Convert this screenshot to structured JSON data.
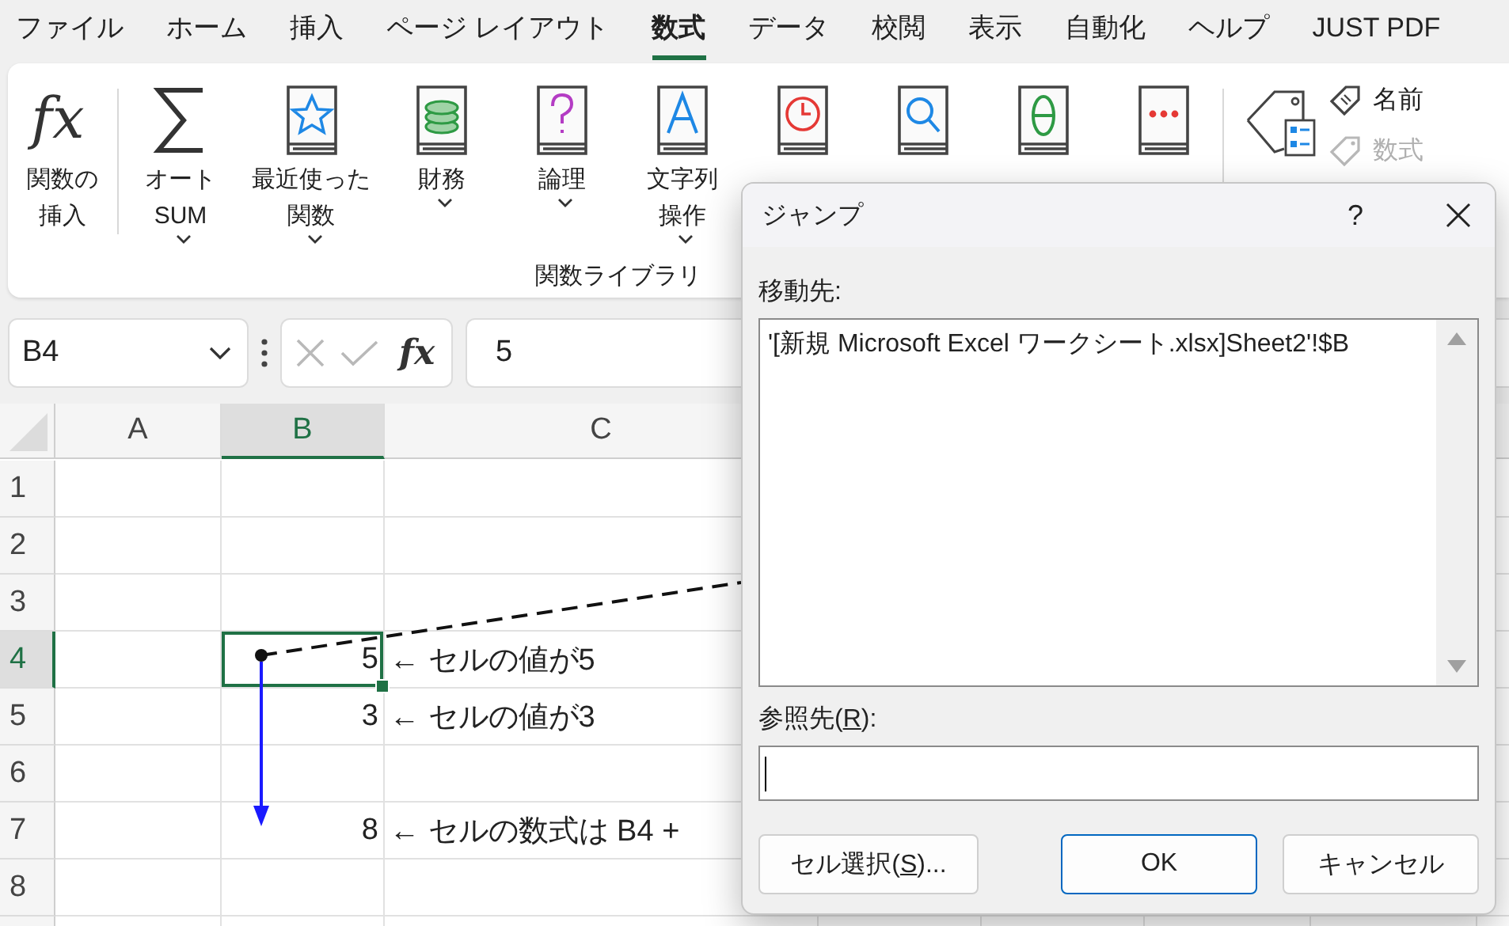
{
  "menu_tabs": [
    {
      "label": "ファイル",
      "selected": false
    },
    {
      "label": "ホーム",
      "selected": false
    },
    {
      "label": "挿入",
      "selected": false
    },
    {
      "label": "ページ レイアウト",
      "selected": false
    },
    {
      "label": "数式",
      "selected": true
    },
    {
      "label": "データ",
      "selected": false
    },
    {
      "label": "校閲",
      "selected": false
    },
    {
      "label": "表示",
      "selected": false
    },
    {
      "label": "自動化",
      "selected": false
    },
    {
      "label": "ヘルプ",
      "selected": false
    },
    {
      "label": "JUST PDF",
      "selected": false
    }
  ],
  "ribbon": {
    "insert_function": {
      "glyph": "fx",
      "label": [
        "関数の",
        "挿入"
      ]
    },
    "library": {
      "title": "関数ライブラリ",
      "items": [
        {
          "kind": "sum",
          "label": [
            "オート",
            "SUM"
          ],
          "dropdown": true
        },
        {
          "kind": "recent",
          "label": [
            "最近使った",
            "関数"
          ],
          "dropdown": true
        },
        {
          "kind": "financial",
          "label": [
            "財務"
          ],
          "dropdown": true
        },
        {
          "kind": "logical",
          "label": [
            "論理"
          ],
          "dropdown": true
        },
        {
          "kind": "text",
          "label": [
            "文字列",
            "操作"
          ],
          "dropdown": true
        },
        {
          "kind": "datetime"
        },
        {
          "kind": "lookup"
        },
        {
          "kind": "math"
        },
        {
          "kind": "more"
        }
      ]
    },
    "names": {
      "small": [
        {
          "kind": "define",
          "label": "名前",
          "disabled": false
        },
        {
          "kind": "formula",
          "label": "数式",
          "disabled": true
        }
      ]
    }
  },
  "formula_bar": {
    "name_box": "B4",
    "fx": "fx",
    "formula": "5"
  },
  "grid": {
    "columns": [
      {
        "label": "A",
        "selected": false
      },
      {
        "label": "B",
        "selected": true
      },
      {
        "label": "C",
        "selected": false
      }
    ],
    "rows": [
      {
        "header": "1",
        "selected": false,
        "cells": [
          null,
          null,
          null
        ]
      },
      {
        "header": "2",
        "selected": false,
        "cells": [
          null,
          null,
          null
        ]
      },
      {
        "header": "3",
        "selected": false,
        "cells": [
          null,
          null,
          null
        ]
      },
      {
        "header": "4",
        "selected": true,
        "cells": [
          null,
          {
            "text": "5",
            "kind": "number"
          },
          {
            "text": "← セルの値が5",
            "kind": "text"
          }
        ]
      },
      {
        "header": "5",
        "selected": false,
        "cells": [
          null,
          {
            "text": "3",
            "kind": "number"
          },
          {
            "text": "← セルの値が3",
            "kind": "text"
          }
        ]
      },
      {
        "header": "6",
        "selected": false,
        "cells": [
          null,
          null,
          null
        ]
      },
      {
        "header": "7",
        "selected": false,
        "cells": [
          null,
          {
            "text": "8",
            "kind": "number"
          },
          {
            "text": "← セルの数式は B4 +",
            "kind": "text"
          }
        ]
      },
      {
        "header": "8",
        "selected": false,
        "cells": [
          null,
          null,
          null
        ]
      }
    ]
  },
  "dialog": {
    "title": "ジャンプ",
    "help": "?",
    "goto_label": "移動先:",
    "goto_items": [
      {
        "text": "'[新規 Microsoft Excel ワークシート.xlsx]Sheet2'!$B",
        "selected": false
      }
    ],
    "reference_label": {
      "before": "参照先(",
      "key": "R",
      "after": "):"
    },
    "buttons": [
      {
        "before": "セル選択(",
        "key": "S",
        "after": ")...",
        "default": false
      },
      {
        "before": "OK",
        "default": true
      },
      {
        "before": "キャンセル",
        "default": false
      }
    ]
  }
}
